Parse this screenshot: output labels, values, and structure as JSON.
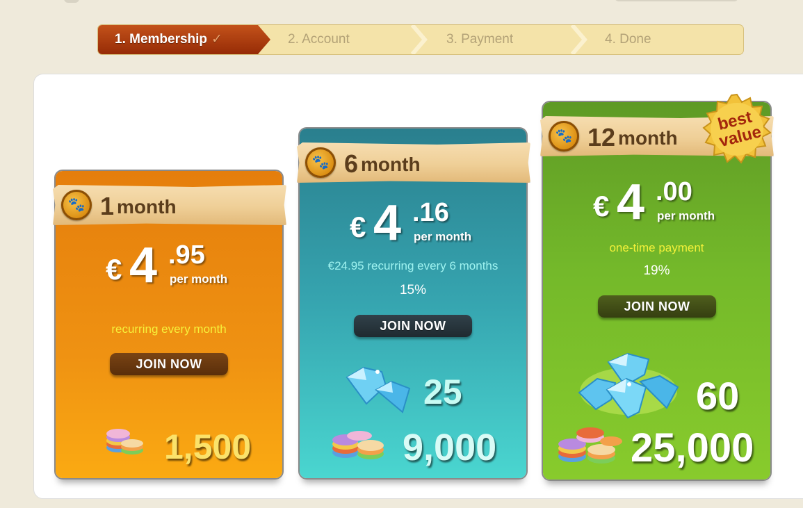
{
  "steps": [
    {
      "label": "1. Membership",
      "state": "active"
    },
    {
      "label": "2. Account",
      "state": "pending"
    },
    {
      "label": "3. Payment",
      "state": "pending"
    },
    {
      "label": "4. Done",
      "state": "pending"
    }
  ],
  "plans": [
    {
      "duration_num": "1",
      "duration_unit": "month",
      "currency": "€",
      "price_int": "4",
      "price_dec": ".95",
      "per": "per month",
      "billing": "recurring every month",
      "billing_color": "#f7f13a",
      "discount": "",
      "join": "JOIN NOW",
      "gems": "",
      "coins": "1,500",
      "theme": "#ef9212"
    },
    {
      "duration_num": "6",
      "duration_unit": "month",
      "currency": "€",
      "price_int": "4",
      "price_dec": ".16",
      "per": "per month",
      "billing": "€24.95 recurring every 6 months",
      "billing_color": "#9ff3f0",
      "discount": "15%",
      "join": "JOIN NOW",
      "gems": "25",
      "coins": "9,000",
      "theme": "#36a5b0"
    },
    {
      "duration_num": "12",
      "duration_unit": "month",
      "currency": "€",
      "price_int": "4",
      "price_dec": ".00",
      "per": "per month",
      "billing": "one-time payment",
      "billing_color": "#f3f13a",
      "discount": "19%",
      "join": "JOIN NOW",
      "gems": "60",
      "coins": "25,000",
      "badge": "best value",
      "theme": "#74b92a"
    }
  ],
  "icons": {
    "step_done": "check-icon",
    "plan": "paw-icon",
    "currency_gems": "diamond-icon",
    "currency_coins": "coins-icon"
  }
}
